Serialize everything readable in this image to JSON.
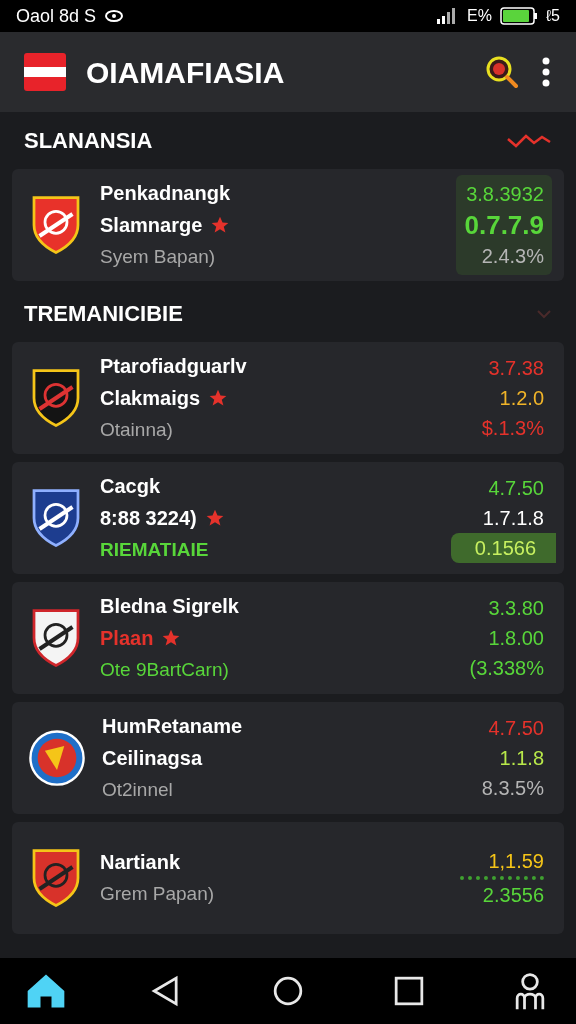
{
  "status_bar": {
    "time": "Oaol 8d S",
    "battery_text": "E%",
    "extra": "ℓ5"
  },
  "header": {
    "title": "OIAMAFIASIA"
  },
  "sections": [
    {
      "title": "SLANANSIA",
      "cards": [
        {
          "crest": {
            "kind": "red"
          },
          "name": "Penkadnangk",
          "subtitle": {
            "text": "Slamnarge",
            "color": "#ffffff",
            "starred": true
          },
          "note": {
            "text": "Syem Bapan)",
            "color": "#a8a8a8",
            "bold": false
          },
          "highlighted": true,
          "values": [
            {
              "text": "3.8.3932",
              "color": "#58d63a",
              "kind": "plain"
            },
            {
              "text": "0.7.7.9",
              "color": "#58d63a",
              "kind": "large"
            },
            {
              "text": "2.4.3%",
              "color": "#b5b5b5",
              "kind": "plain"
            }
          ]
        }
      ]
    },
    {
      "title": "TREMANICIBIE",
      "cards": [
        {
          "crest": {
            "kind": "black"
          },
          "name": "Ptarofiadguarlv",
          "subtitle": {
            "text": "Clakmaigs",
            "color": "#ffffff",
            "starred": true
          },
          "note": {
            "text": "Otainna)",
            "color": "#a8a8a8",
            "bold": false
          },
          "highlighted": false,
          "values": [
            {
              "text": "3.7.38",
              "color": "#e5322b",
              "kind": "plain"
            },
            {
              "text": "1.2.0",
              "color": "#f0b429",
              "kind": "plain"
            },
            {
              "text": "$.1.3%",
              "color": "#e5322b",
              "kind": "plain"
            }
          ]
        },
        {
          "crest": {
            "kind": "blue"
          },
          "name": "Cacgk",
          "subtitle": {
            "text": "8:88 3224)",
            "color": "#ffffff",
            "starred": true
          },
          "note": {
            "text": "RIEMATIAIE",
            "color": "#58d63a",
            "bold": true
          },
          "highlighted": false,
          "values": [
            {
              "text": "4.7.50",
              "color": "#58d63a",
              "kind": "plain"
            },
            {
              "text": "1.7.1.8",
              "color": "#ffffff",
              "kind": "plain"
            },
            {
              "text": "0.1566",
              "color": "#c8f060",
              "kind": "pill"
            }
          ]
        },
        {
          "crest": {
            "kind": "white"
          },
          "name": "Bledna Sigrelk",
          "subtitle": {
            "text": "Plaan",
            "color": "#e5322b",
            "starred": true
          },
          "note": {
            "text": "Ote 9BartCarn)",
            "color": "#58d63a",
            "bold": false
          },
          "highlighted": false,
          "values": [
            {
              "text": "3.3.80",
              "color": "#58d63a",
              "kind": "plain"
            },
            {
              "text": "1.8.00",
              "color": "#58d63a",
              "kind": "plain"
            },
            {
              "text": "(3.338%",
              "color": "#58d63a",
              "kind": "plain"
            }
          ]
        },
        {
          "crest": {
            "kind": "round"
          },
          "name": "HumRetaname",
          "subtitle": {
            "text": "Ceilinagsa",
            "color": "#ffffff",
            "starred": false
          },
          "note": {
            "text": "Ot2innel",
            "color": "#a8a8a8",
            "bold": false
          },
          "highlighted": false,
          "values": [
            {
              "text": "4.7.50",
              "color": "#e5322b",
              "kind": "plain"
            },
            {
              "text": "1.1.8",
              "color": "#b8e84a",
              "kind": "plain"
            },
            {
              "text": "8.3.5%",
              "color": "#b5b5b5",
              "kind": "plain"
            }
          ]
        },
        {
          "crest": {
            "kind": "flame"
          },
          "name": "Nartiank",
          "note": {
            "text": "Grem Papan)",
            "color": "#a8a8a8",
            "bold": false
          },
          "highlighted": false,
          "values": [
            {
              "text": "1,1.59",
              "color": "#f5c518",
              "kind": "dotted"
            },
            {
              "text": "2.3556",
              "color": "#58d63a",
              "kind": "plain"
            }
          ]
        }
      ]
    }
  ],
  "nav": [
    {
      "kind": "home",
      "selected": true
    },
    {
      "kind": "back",
      "selected": false
    },
    {
      "kind": "circle",
      "selected": false
    },
    {
      "kind": "square",
      "selected": false
    },
    {
      "kind": "person",
      "selected": false
    }
  ]
}
